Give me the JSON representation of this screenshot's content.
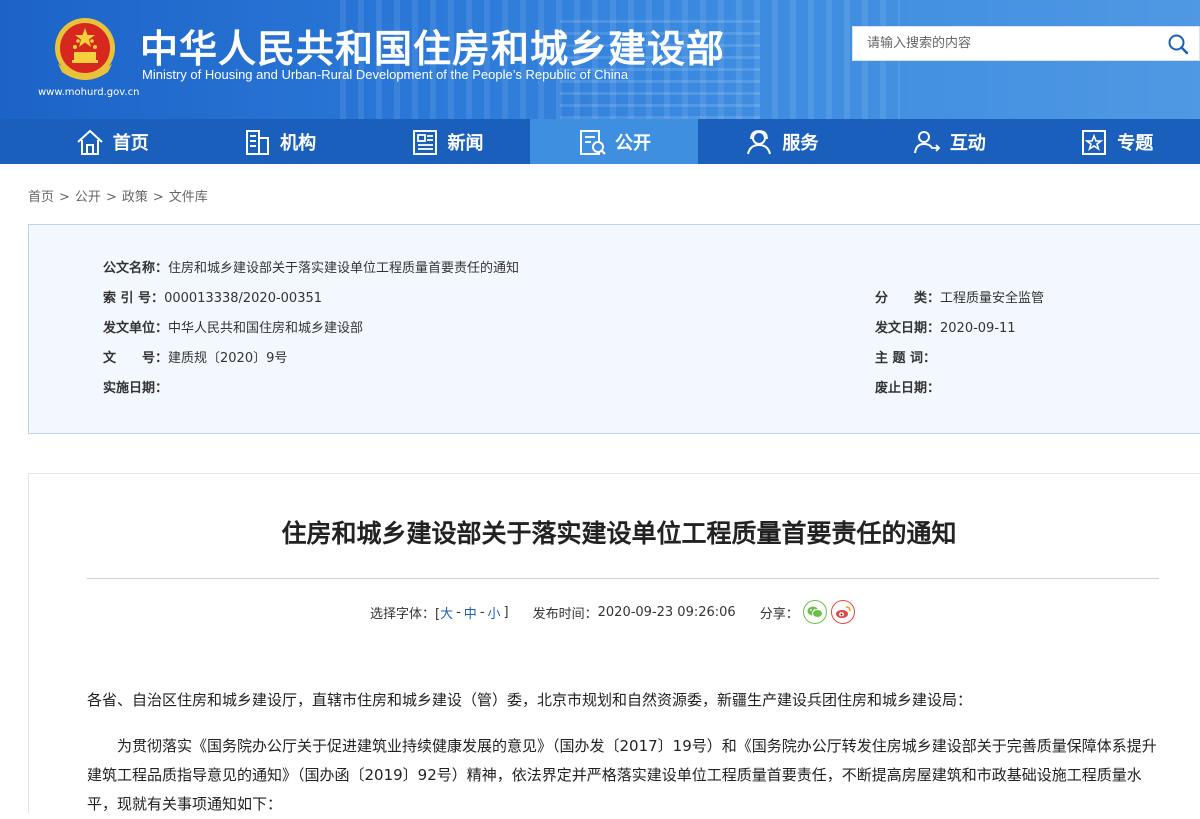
{
  "header": {
    "title_cn": "中华人民共和国住房和城乡建设部",
    "title_en": "Ministry of Housing and Urban-Rural Development of the People’s Republic of China",
    "url": "www.mohurd.gov.cn",
    "search_placeholder": "请输入搜索的内容"
  },
  "nav": {
    "items": [
      {
        "label": "首页",
        "icon": "home-icon"
      },
      {
        "label": "机构",
        "icon": "building-icon"
      },
      {
        "label": "新闻",
        "icon": "news-icon"
      },
      {
        "label": "公开",
        "icon": "open-doc-icon"
      },
      {
        "label": "服务",
        "icon": "service-icon"
      },
      {
        "label": "互动",
        "icon": "interact-icon"
      },
      {
        "label": "专题",
        "icon": "topic-icon"
      }
    ],
    "active_index": 3
  },
  "breadcrumb": [
    "首页",
    "公开",
    "政策",
    "文件库"
  ],
  "info": {
    "doc_name_label": "公文名称：",
    "doc_name": "住房和城乡建设部关于落实建设单位工程质量首要责任的通知",
    "index_label": "索 引 号：",
    "index": "000013338/2020-00351",
    "category_label": "分　　类：",
    "category": "工程质量安全监管",
    "issuer_label": "发文单位：",
    "issuer": "中华人民共和国住房和城乡建设部",
    "issue_date_label": "发文日期：",
    "issue_date": "2020-09-11",
    "doc_no_label": "文　　号：",
    "doc_no": "建质规〔2020〕9号",
    "subject_label": "主 题 词：",
    "subject": "",
    "effective_label": "实施日期：",
    "effective": "",
    "expiry_label": "废止日期：",
    "expiry": ""
  },
  "article": {
    "title": "住房和城乡建设部关于落实建设单位工程质量首要责任的通知",
    "font_label": "选择字体：[",
    "size_large": "大",
    "size_medium": "中",
    "size_small": "小",
    "font_label_end": "]",
    "dash": "-",
    "publish_label": "发布时间：",
    "publish_time": "2020-09-23 09:26:06",
    "share_label": "分享：",
    "para1": "各省、自治区住房和城乡建设厅，直辖市住房和城乡建设（管）委，北京市规划和自然资源委，新疆生产建设兵团住房和城乡建设局：",
    "para2": "　　为贯彻落实《国务院办公厅关于促进建筑业持续健康发展的意见》（国办发〔2017〕19号）和《国务院办公厅转发住房城乡建设部关于完善质量保障体系提升建筑工程品质指导意见的通知》（国办函〔2019〕92号）精神，依法界定并严格落实建设单位工程质量首要责任，不断提高房屋建筑和市政基础设施工程质量水平，现就有关事项通知如下："
  },
  "colors": {
    "header_blue": "#2a78d8",
    "nav_blue": "#1b5fbd",
    "nav_active": "#3f8fe0",
    "panel_bg": "#f3f8fe"
  }
}
